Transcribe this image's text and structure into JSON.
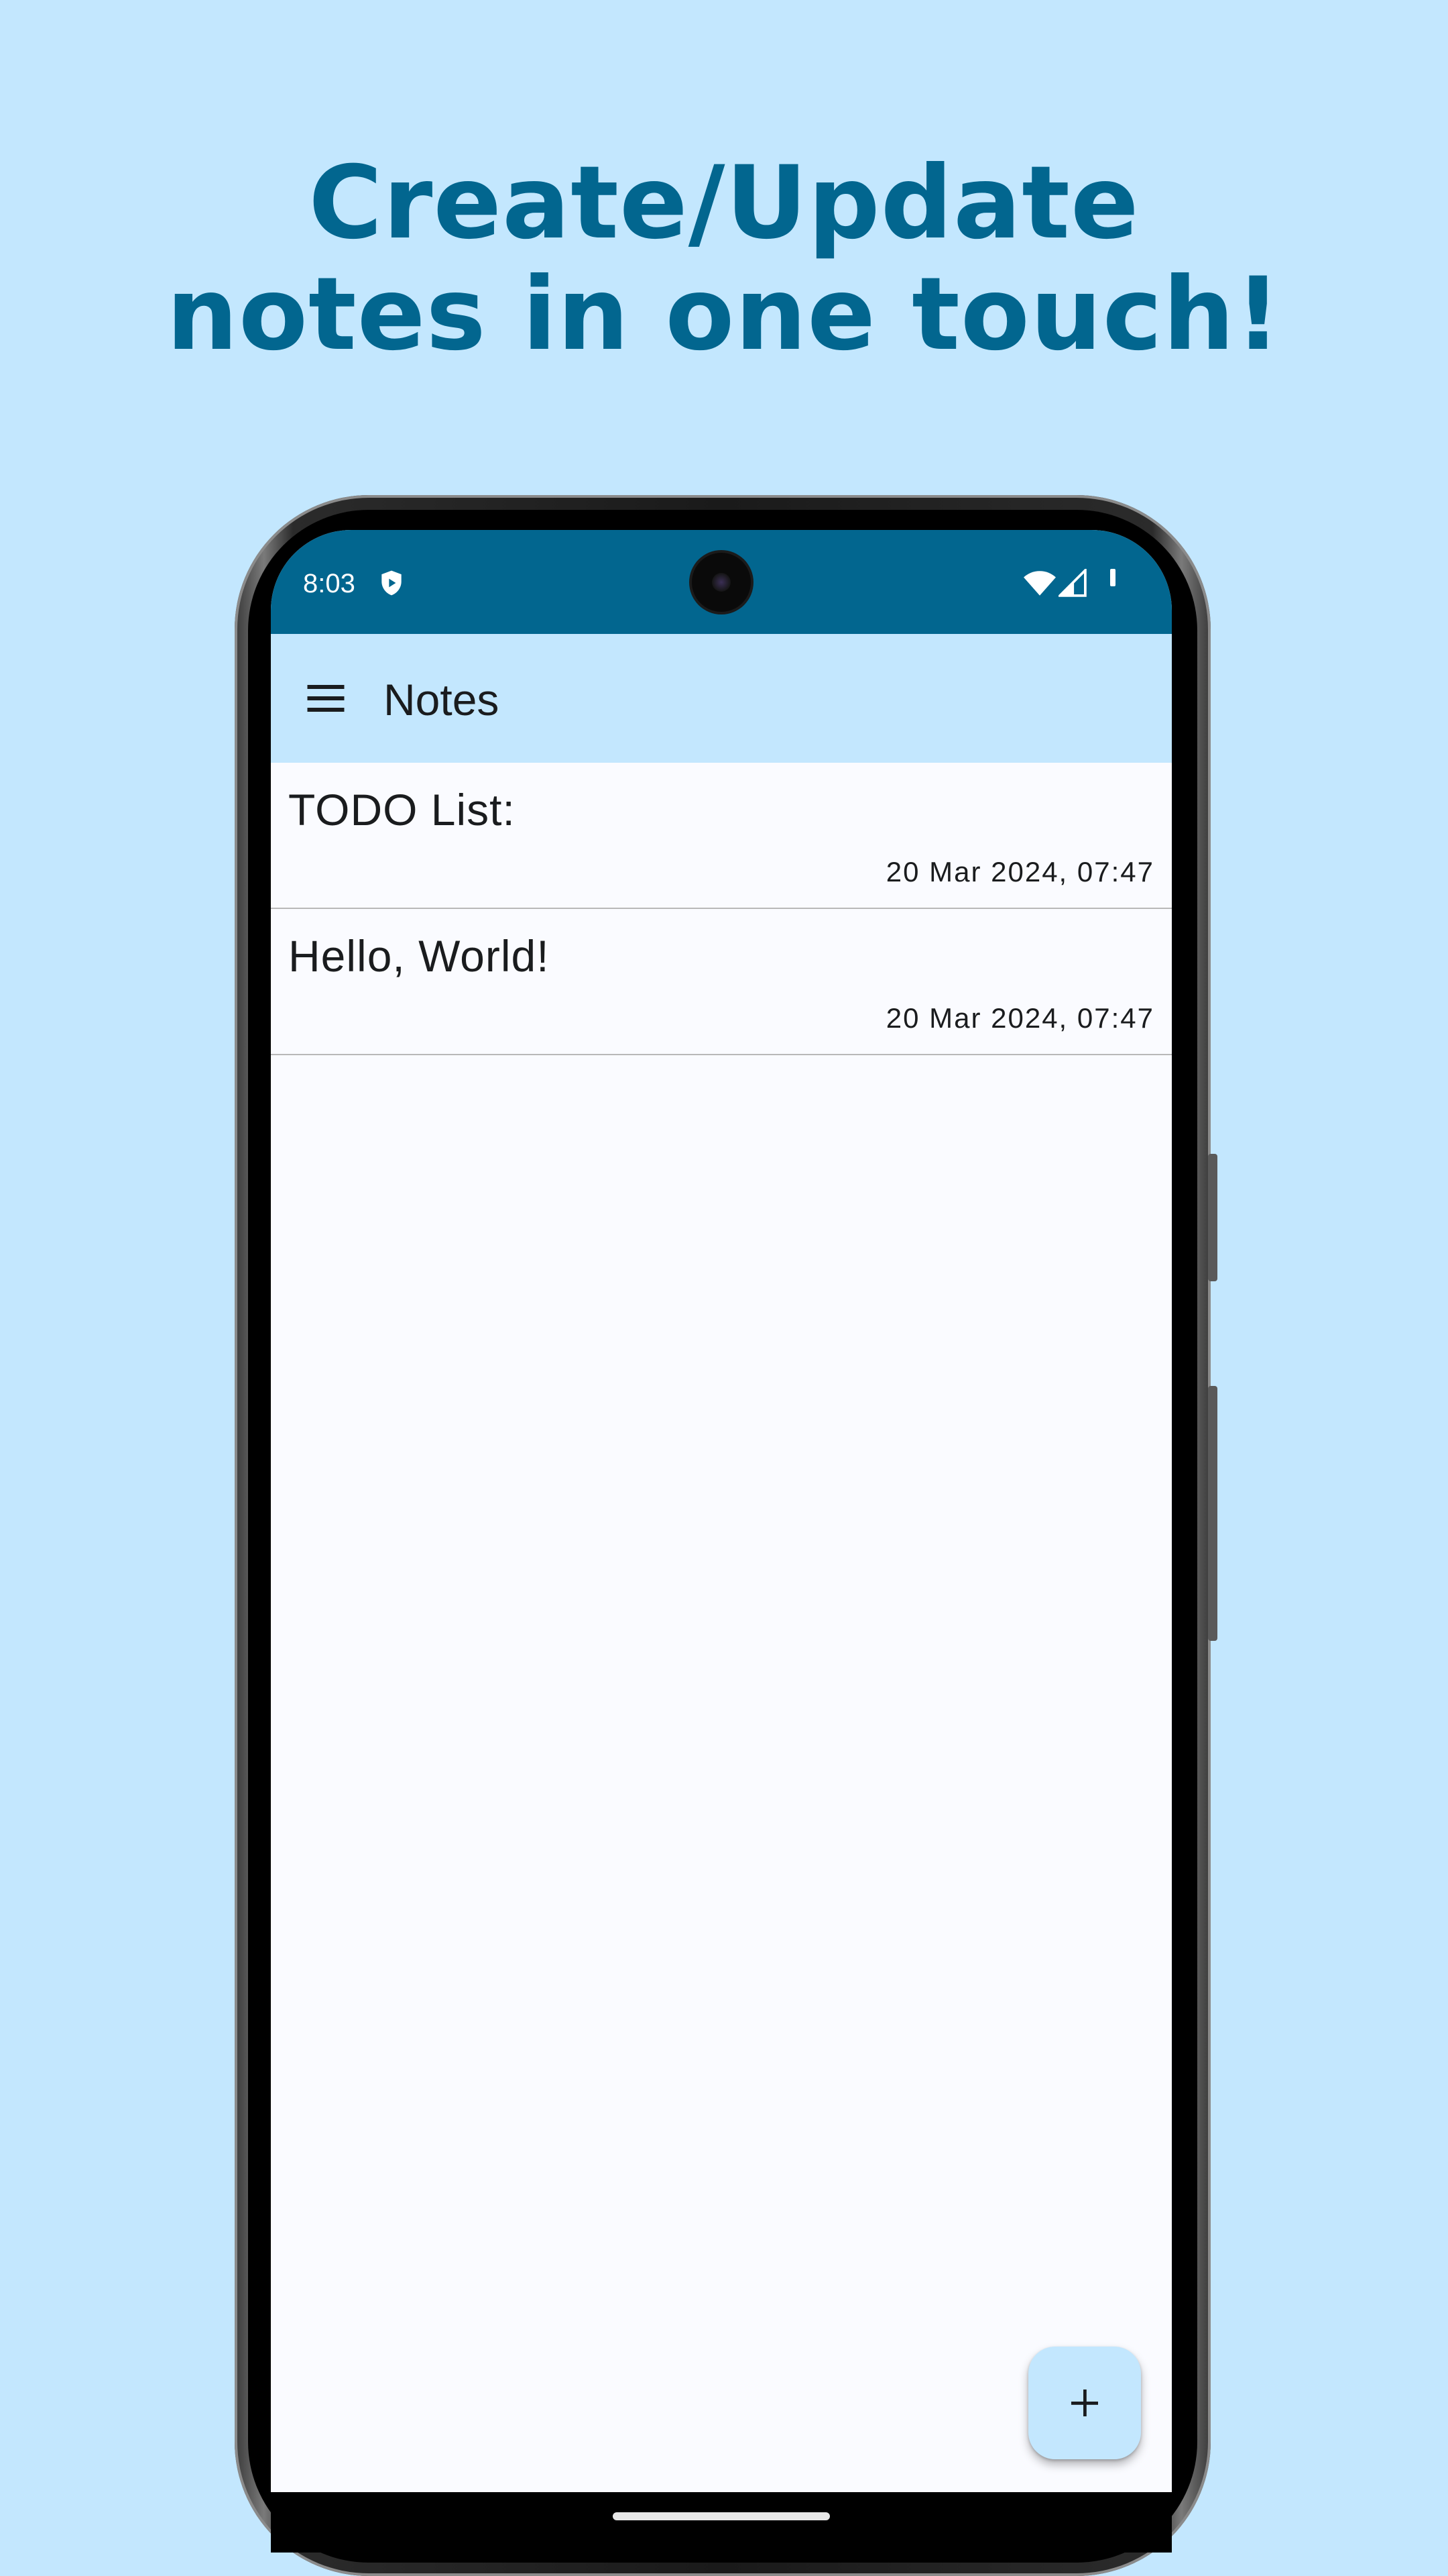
{
  "headline": {
    "line1": "Create/Update",
    "line2": "notes in one touch!"
  },
  "status_bar": {
    "time": "8:03",
    "icons": [
      "shield-icon",
      "wifi-icon",
      "cellular-signal-icon",
      "battery-icon"
    ]
  },
  "app_bar": {
    "menu_icon": "hamburger-menu-icon",
    "title": "Notes"
  },
  "notes": [
    {
      "title": "TODO List:",
      "timestamp": "20 Mar 2024, 07:47"
    },
    {
      "title": "Hello, World!",
      "timestamp": "20 Mar 2024, 07:47"
    }
  ],
  "fab": {
    "icon": "plus-icon"
  },
  "colors": {
    "background": "#c3e7fe",
    "headline": "#02668f",
    "status_bar": "#02668f",
    "app_bar": "#c3e7fe",
    "list_background": "#fafbff",
    "divider": "#b8b8b8",
    "fab": "#c3e7fe"
  }
}
